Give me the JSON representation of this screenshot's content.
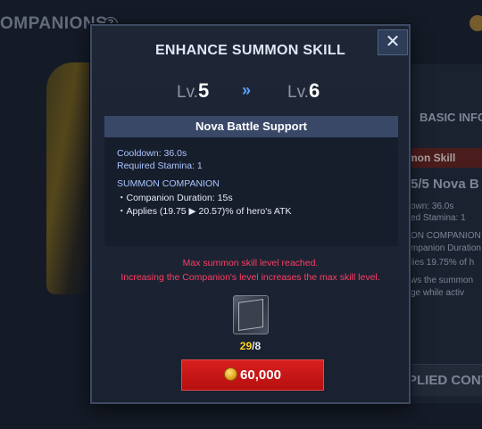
{
  "background": {
    "title": "OMPANIONS",
    "help_glyph": "?",
    "basic_info": "BASIC INFO",
    "skill_header": "mon Skill",
    "skill_level": "5/5  Nova B",
    "lines": [
      "own: 36.0s",
      "ed Stamina: 1",
      "ON COMPANION",
      "mpanion Duration",
      "lies 19.75% of h",
      "ws the summon",
      "ge while activ"
    ],
    "applied_button": "PLIED CONT"
  },
  "modal": {
    "title": "ENHANCE SUMMON SKILL",
    "close_glyph": "✕",
    "level": {
      "prefix": "Lv.",
      "from": "5",
      "arrow": "»",
      "to": "6"
    },
    "skill_name": "Nova Battle Support",
    "stats": {
      "cooldown": "Cooldown: 36.0s",
      "stamina": "Required Stamina: 1"
    },
    "section_title": "SUMMON COMPANION",
    "effects": [
      "・Companion Duration: 15s",
      "・Applies (19.75 ▶ 20.57)% of hero's ATK"
    ],
    "messages": [
      "Max summon skill level reached.",
      "Increasing the Companion's level increases the max skill level."
    ],
    "material": {
      "icon": "companion-card-icon",
      "have": "29",
      "separator": "/",
      "need": "8"
    },
    "cost_button": {
      "icon": "gold-coin-icon",
      "amount": "60,000"
    }
  },
  "colors": {
    "accent_blue": "#5ea1ff",
    "warning_red": "#ff3d63",
    "count_yellow": "#ffd21f",
    "button_red": "#c8161a"
  }
}
